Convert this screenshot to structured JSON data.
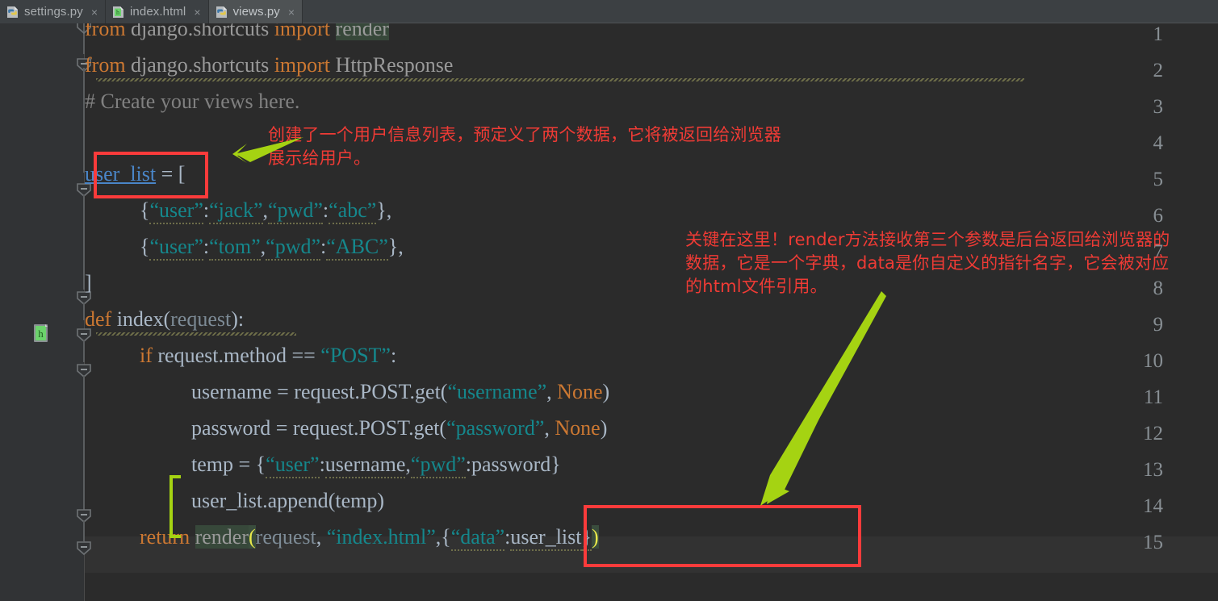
{
  "window": {
    "app": "PyCharm IDE editor",
    "background_color": "#2b2b2b",
    "gutter_color": "#313335",
    "tabbar_color": "#3c4043",
    "accent_red": "#fb3b3b",
    "accent_green": "#a5d312",
    "string_color": "#15878c",
    "keyword_color": "#cc7832"
  },
  "tabs": [
    {
      "label": "settings.py",
      "icon": "python-file-icon",
      "close": "×",
      "active": false
    },
    {
      "label": "index.html",
      "icon": "html-file-icon",
      "close": "×",
      "active": false
    },
    {
      "label": "views.py",
      "icon": "python-file-icon",
      "close": "×",
      "active": true
    }
  ],
  "gutter": {
    "line_numbers": [
      "1",
      "2",
      "3",
      "4",
      "5",
      "6",
      "7",
      "8",
      "9",
      "10",
      "11",
      "12",
      "13",
      "14",
      "15"
    ],
    "html_nav_icon": "html-file-gutter-icon"
  },
  "code": {
    "lines": [
      {
        "n": "1",
        "text": "from django.shortcuts import render"
      },
      {
        "n": "2",
        "text": "from django.shortcuts import HttpResponse"
      },
      {
        "n": "3",
        "text": "# Create your views here."
      },
      {
        "n": "4",
        "text": ""
      },
      {
        "n": "5",
        "text": "user_list = ["
      },
      {
        "n": "6",
        "text": "    {“user”:“jack”,“pwd”:“abc”},"
      },
      {
        "n": "7",
        "text": "    {“user”:“tom”,“pwd”:“ABC”},"
      },
      {
        "n": "8",
        "text": "]"
      },
      {
        "n": "9",
        "text": "def index(request):"
      },
      {
        "n": "10",
        "text": "    if request.method == “POST”:"
      },
      {
        "n": "11",
        "text": "        username = request.POST.get(“username”, None)"
      },
      {
        "n": "12",
        "text": "        password = request.POST.get(“password”, None)"
      },
      {
        "n": "13",
        "text": "        temp = {“user”:username,“pwd”:password}"
      },
      {
        "n": "14",
        "text": "        user_list.append(temp)"
      },
      {
        "n": "15",
        "text": "    return render(request, “index.html”,{“data”:user_list})"
      }
    ],
    "tokens": {
      "from": "from",
      "import": "import",
      "django_shortcuts": "django.shortcuts",
      "render": "render",
      "HttpResponse": "HttpResponse",
      "comment": "# Create your views here.",
      "user_list": "user_list",
      "eq": " = ",
      "open_bracket": "[",
      "close_bracket": "]",
      "dict1": {
        "k1": "“user”",
        "v1": "“jack”",
        "k2": "“pwd”",
        "v2": "“abc”"
      },
      "dict2": {
        "k1": "“user”",
        "v1": "“tom”",
        "k2": "“pwd”",
        "v2": "“ABC”"
      },
      "def": "def",
      "index": "index",
      "request": "request",
      "if": "if",
      "request_method": "request.method",
      "eqeq": " == ",
      "post_str": "“POST”",
      "username_var": "username",
      "password_var": "password",
      "request_post_get": "request.POST.get",
      "username_str": "“username”",
      "password_str": "“password”",
      "none": "None",
      "temp": "temp",
      "user_key": "“user”",
      "pwd_key": "“pwd”",
      "append": "user_list.append",
      "temp_arg": "temp",
      "return": "return",
      "index_html_str": "“index.html”",
      "data_key": "“data”",
      "user_list_val": "user_list"
    }
  },
  "annotations": [
    {
      "id": "annotation-user-list",
      "text": "创建了一个用户信息列表，预定义了两个数据，它将被返回给浏览器\n展示给用户。",
      "color": "#ef3b35"
    },
    {
      "id": "annotation-render",
      "text": "关键在这里！render方法接收第三个参数是后台返回给浏览器的\n数据，它是一个字典，data是你自定义的指针名字，它会被对应\n的html文件引用。",
      "color": "#ef3b35"
    }
  ],
  "markers": {
    "red_box_user_list": "highlight-box-user-list",
    "red_box_render_dict": "highlight-box-render-dict",
    "green_bracket": "code-block-bracket-marker",
    "arrow_short": "arrow-pointing-to-user-list",
    "arrow_long": "arrow-pointing-to-render-dict"
  }
}
